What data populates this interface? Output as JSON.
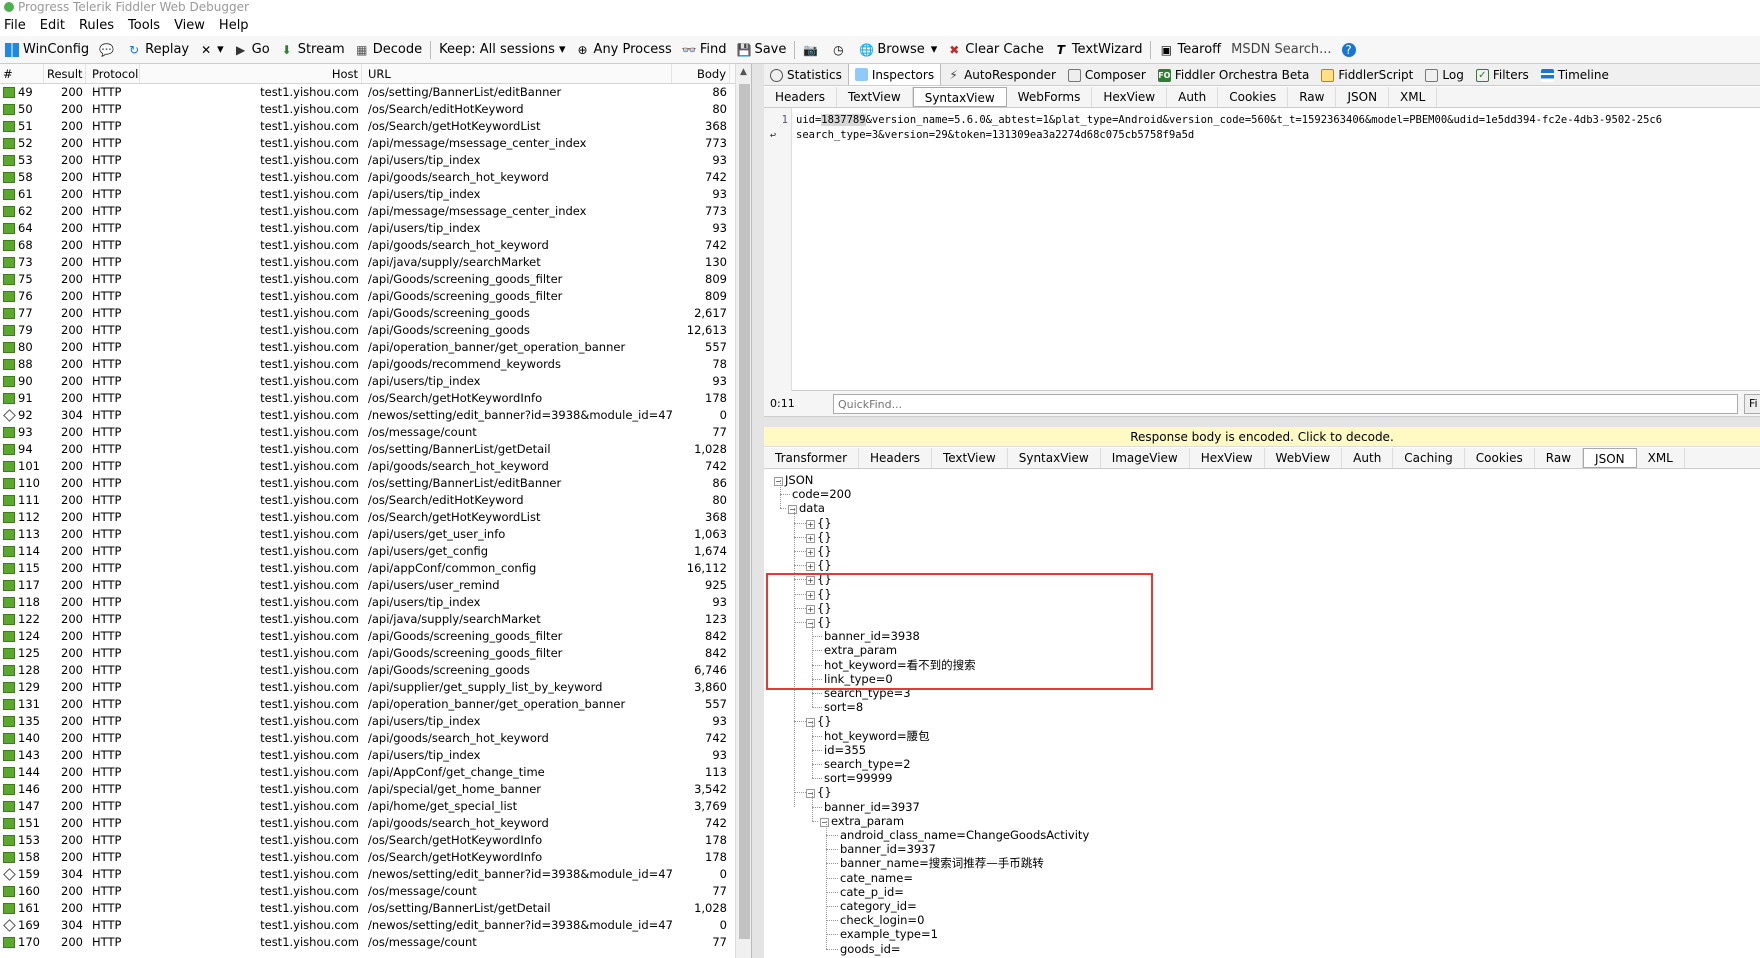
{
  "window": {
    "title": "Progress Telerik Fiddler Web Debugger"
  },
  "menu": [
    "File",
    "Edit",
    "Rules",
    "Tools",
    "View",
    "Help"
  ],
  "toolbar": {
    "winconfig": "WinConfig",
    "replay": "Replay",
    "remove": "▾",
    "go": "Go",
    "stream": "Stream",
    "decode": "Decode",
    "keep": "Keep: All sessions ▾",
    "any_process": "Any Process",
    "find": "Find",
    "save": "Save",
    "browse": "Browse",
    "clear_cache": "Clear Cache",
    "textwizard": "TextWizard",
    "tearoff": "Tearoff",
    "msdn_search": "MSDN Search..."
  },
  "sessions": {
    "columns": [
      "#",
      "Result",
      "Protocol",
      "Host",
      "URL",
      "Body"
    ],
    "rows": [
      [
        "49",
        "200",
        "HTTP",
        "test1.yishou.com",
        "/os/setting/BannerList/editBanner",
        "86"
      ],
      [
        "50",
        "200",
        "HTTP",
        "test1.yishou.com",
        "/os/Search/editHotKeyword",
        "80"
      ],
      [
        "51",
        "200",
        "HTTP",
        "test1.yishou.com",
        "/os/Search/getHotKeywordList",
        "368"
      ],
      [
        "52",
        "200",
        "HTTP",
        "test1.yishou.com",
        "/api/message/msessage_center_index",
        "773"
      ],
      [
        "53",
        "200",
        "HTTP",
        "test1.yishou.com",
        "/api/users/tip_index",
        "93"
      ],
      [
        "58",
        "200",
        "HTTP",
        "test1.yishou.com",
        "/api/goods/search_hot_keyword",
        "742"
      ],
      [
        "61",
        "200",
        "HTTP",
        "test1.yishou.com",
        "/api/users/tip_index",
        "93"
      ],
      [
        "62",
        "200",
        "HTTP",
        "test1.yishou.com",
        "/api/message/msessage_center_index",
        "773"
      ],
      [
        "64",
        "200",
        "HTTP",
        "test1.yishou.com",
        "/api/users/tip_index",
        "93"
      ],
      [
        "68",
        "200",
        "HTTP",
        "test1.yishou.com",
        "/api/goods/search_hot_keyword",
        "742"
      ],
      [
        "73",
        "200",
        "HTTP",
        "test1.yishou.com",
        "/api/java/supply/searchMarket",
        "130"
      ],
      [
        "75",
        "200",
        "HTTP",
        "test1.yishou.com",
        "/api/Goods/screening_goods_filter",
        "809"
      ],
      [
        "76",
        "200",
        "HTTP",
        "test1.yishou.com",
        "/api/Goods/screening_goods_filter",
        "809"
      ],
      [
        "77",
        "200",
        "HTTP",
        "test1.yishou.com",
        "/api/Goods/screening_goods",
        "2,617"
      ],
      [
        "79",
        "200",
        "HTTP",
        "test1.yishou.com",
        "/api/Goods/screening_goods",
        "12,613"
      ],
      [
        "80",
        "200",
        "HTTP",
        "test1.yishou.com",
        "/api/operation_banner/get_operation_banner",
        "557"
      ],
      [
        "88",
        "200",
        "HTTP",
        "test1.yishou.com",
        "/api/goods/recommend_keywords",
        "78"
      ],
      [
        "90",
        "200",
        "HTTP",
        "test1.yishou.com",
        "/api/users/tip_index",
        "93"
      ],
      [
        "91",
        "200",
        "HTTP",
        "test1.yishou.com",
        "/os/Search/getHotKeywordInfo",
        "178"
      ],
      [
        "92",
        "304",
        "HTTP",
        "test1.yishou.com",
        "/newos/setting/edit_banner?id=3938&module_id=47",
        "0"
      ],
      [
        "93",
        "200",
        "HTTP",
        "test1.yishou.com",
        "/os/message/count",
        "77"
      ],
      [
        "94",
        "200",
        "HTTP",
        "test1.yishou.com",
        "/os/setting/BannerList/getDetail",
        "1,028"
      ],
      [
        "101",
        "200",
        "HTTP",
        "test1.yishou.com",
        "/api/goods/search_hot_keyword",
        "742"
      ],
      [
        "110",
        "200",
        "HTTP",
        "test1.yishou.com",
        "/os/setting/BannerList/editBanner",
        "86"
      ],
      [
        "111",
        "200",
        "HTTP",
        "test1.yishou.com",
        "/os/Search/editHotKeyword",
        "80"
      ],
      [
        "112",
        "200",
        "HTTP",
        "test1.yishou.com",
        "/os/Search/getHotKeywordList",
        "368"
      ],
      [
        "113",
        "200",
        "HTTP",
        "test1.yishou.com",
        "/api/users/get_user_info",
        "1,063"
      ],
      [
        "114",
        "200",
        "HTTP",
        "test1.yishou.com",
        "/api/users/get_config",
        "1,674"
      ],
      [
        "115",
        "200",
        "HTTP",
        "test1.yishou.com",
        "/api/appConf/common_config",
        "16,112"
      ],
      [
        "117",
        "200",
        "HTTP",
        "test1.yishou.com",
        "/api/users/user_remind",
        "925"
      ],
      [
        "118",
        "200",
        "HTTP",
        "test1.yishou.com",
        "/api/users/tip_index",
        "93"
      ],
      [
        "122",
        "200",
        "HTTP",
        "test1.yishou.com",
        "/api/java/supply/searchMarket",
        "123"
      ],
      [
        "124",
        "200",
        "HTTP",
        "test1.yishou.com",
        "/api/Goods/screening_goods_filter",
        "842"
      ],
      [
        "125",
        "200",
        "HTTP",
        "test1.yishou.com",
        "/api/Goods/screening_goods_filter",
        "842"
      ],
      [
        "128",
        "200",
        "HTTP",
        "test1.yishou.com",
        "/api/Goods/screening_goods",
        "6,746"
      ],
      [
        "129",
        "200",
        "HTTP",
        "test1.yishou.com",
        "/api/supplier/get_supply_list_by_keyword",
        "3,860"
      ],
      [
        "131",
        "200",
        "HTTP",
        "test1.yishou.com",
        "/api/operation_banner/get_operation_banner",
        "557"
      ],
      [
        "135",
        "200",
        "HTTP",
        "test1.yishou.com",
        "/api/users/tip_index",
        "93"
      ],
      [
        "140",
        "200",
        "HTTP",
        "test1.yishou.com",
        "/api/goods/search_hot_keyword",
        "742"
      ],
      [
        "143",
        "200",
        "HTTP",
        "test1.yishou.com",
        "/api/users/tip_index",
        "93"
      ],
      [
        "144",
        "200",
        "HTTP",
        "test1.yishou.com",
        "/api/AppConf/get_change_time",
        "113"
      ],
      [
        "146",
        "200",
        "HTTP",
        "test1.yishou.com",
        "/api/special/get_home_banner",
        "3,542"
      ],
      [
        "147",
        "200",
        "HTTP",
        "test1.yishou.com",
        "/api/home/get_special_list",
        "3,769"
      ],
      [
        "151",
        "200",
        "HTTP",
        "test1.yishou.com",
        "/api/goods/search_hot_keyword",
        "742"
      ],
      [
        "153",
        "200",
        "HTTP",
        "test1.yishou.com",
        "/os/Search/getHotKeywordInfo",
        "178"
      ],
      [
        "158",
        "200",
        "HTTP",
        "test1.yishou.com",
        "/os/Search/getHotKeywordInfo",
        "178"
      ],
      [
        "159",
        "304",
        "HTTP",
        "test1.yishou.com",
        "/newos/setting/edit_banner?id=3938&module_id=47",
        "0"
      ],
      [
        "160",
        "200",
        "HTTP",
        "test1.yishou.com",
        "/os/message/count",
        "77"
      ],
      [
        "161",
        "200",
        "HTTP",
        "test1.yishou.com",
        "/os/setting/BannerList/getDetail",
        "1,028"
      ],
      [
        "169",
        "304",
        "HTTP",
        "test1.yishou.com",
        "/newos/setting/edit_banner?id=3938&module_id=47",
        "0"
      ],
      [
        "170",
        "200",
        "HTTP",
        "test1.yishou.com",
        "/os/message/count",
        "77"
      ]
    ]
  },
  "inspector": {
    "main_tabs": [
      "Statistics",
      "Inspectors",
      "AutoResponder",
      "Composer",
      "Fiddler Orchestra Beta",
      "FiddlerScript",
      "Log",
      "Filters",
      "Timeline"
    ],
    "request_tabs": [
      "Headers",
      "TextView",
      "SyntaxView",
      "WebForms",
      "HexView",
      "Auth",
      "Cookies",
      "Raw",
      "JSON",
      "XML"
    ],
    "request_body": {
      "line_no": "1",
      "line1_pre": "uid=",
      "line1_hl": "1837789",
      "line1_post": "&version_name=5.6.0&_abtest=1&plat_type=Android&version_code=560&t_t=1592363406&model=PBEM00&udid=1e5dd394-fc2e-4db3-9502-25c6",
      "line2": "search_type=3&version=29&token=131309ea3a2274d68c075cb5758f9a5d"
    },
    "position": "0:11",
    "quickfind_placeholder": "QuickFind...",
    "find_button": "Fi",
    "decode_notice": "Response body is encoded. Click to decode.",
    "response_tabs": [
      "Transformer",
      "Headers",
      "TextView",
      "SyntaxView",
      "ImageView",
      "HexView",
      "WebView",
      "Auth",
      "Caching",
      "Cookies",
      "Raw",
      "JSON",
      "XML"
    ],
    "json_tree": {
      "root": "JSON",
      "code": "code=200",
      "data": "data",
      "collapsed_item": "{}",
      "item1": [
        "banner_id=3938",
        "extra_param",
        "hot_keyword=看不到的搜索",
        "link_type=0",
        "search_type=3",
        "sort=8"
      ],
      "item2": [
        "hot_keyword=腰包",
        "id=355",
        "search_type=2",
        "sort=99999"
      ],
      "item3_banner": "banner_id=3937",
      "item3_extra": "extra_param",
      "item3_extra_children": [
        "android_class_name=ChangeGoodsActivity",
        "banner_id=3937",
        "banner_name=搜索词推荐—手币跳转",
        "cate_name=",
        "cate_p_id=",
        "category_id=",
        "check_login=0",
        "example_type=1",
        "goods_id="
      ]
    }
  }
}
